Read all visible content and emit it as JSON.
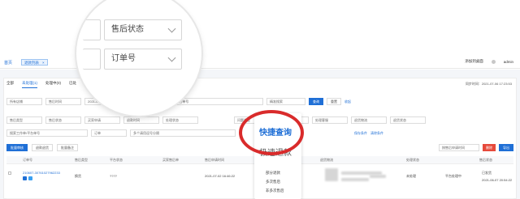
{
  "nav": {
    "home": "首页",
    "tab": "退款列表",
    "tab_close": "×",
    "add_app": "添加到桌面",
    "user": "admin"
  },
  "status_tabs": [
    "全部",
    "未处理(1)",
    "处理中(0)",
    "已处"
  ],
  "sync_time": "同步时间：2021-07-06 17:23:53",
  "filter_row1": {
    "shop": "所有店铺",
    "time_type": "售后时间",
    "date": "2021-0",
    "date_end": "8:17",
    "search_placeholder": "订单号/退货物流单号/售后单号",
    "exact": "精准搜索",
    "query": "查询",
    "reset": "重置",
    "collapse": "收起"
  },
  "filter_row2": [
    "售后类型",
    "售后状态",
    "买家申请",
    "退款时间",
    "处理状态",
    "问题类型",
    "退款原因",
    "处理客服",
    "退货物流",
    "退货状态"
  ],
  "filter_row3": [
    "搜索工作单/平台单号",
    "订单",
    "多个请用逗号分隔",
    "商品名称"
  ],
  "filter_row3_links": [
    "保存条件",
    "清除条件"
  ],
  "toolbar": {
    "left": [
      "批量审核",
      "退款退货",
      "批量备注"
    ],
    "sort": "按售后申请时间",
    "del": "删除",
    "export": "导出"
  },
  "table_headers": [
    "订单号",
    "售后类型",
    "平台状态",
    "买家售后单",
    "售后申请时间",
    "退款金额",
    "问题类型",
    "退货物流",
    "客服",
    "处理状态",
    "售后状态"
  ],
  "row": {
    "order": "210607-30761027962233",
    "type": "换货",
    "plat": "????",
    "apply_time": "2021-07-02 16:46:22",
    "problem": "不退仅退",
    "status": "未处理",
    "plat_status": "平台处理中",
    "done": "已发货",
    "done_time": "2021-06-07 20:54:22"
  },
  "magnifier": {
    "field1": "售后状态",
    "field2": "订单号"
  },
  "popup": {
    "quick_query": "快捷查询",
    "quick_refund": "极速退款",
    "items": [
      "部分退款",
      "多次售后",
      "非多次售后"
    ]
  }
}
